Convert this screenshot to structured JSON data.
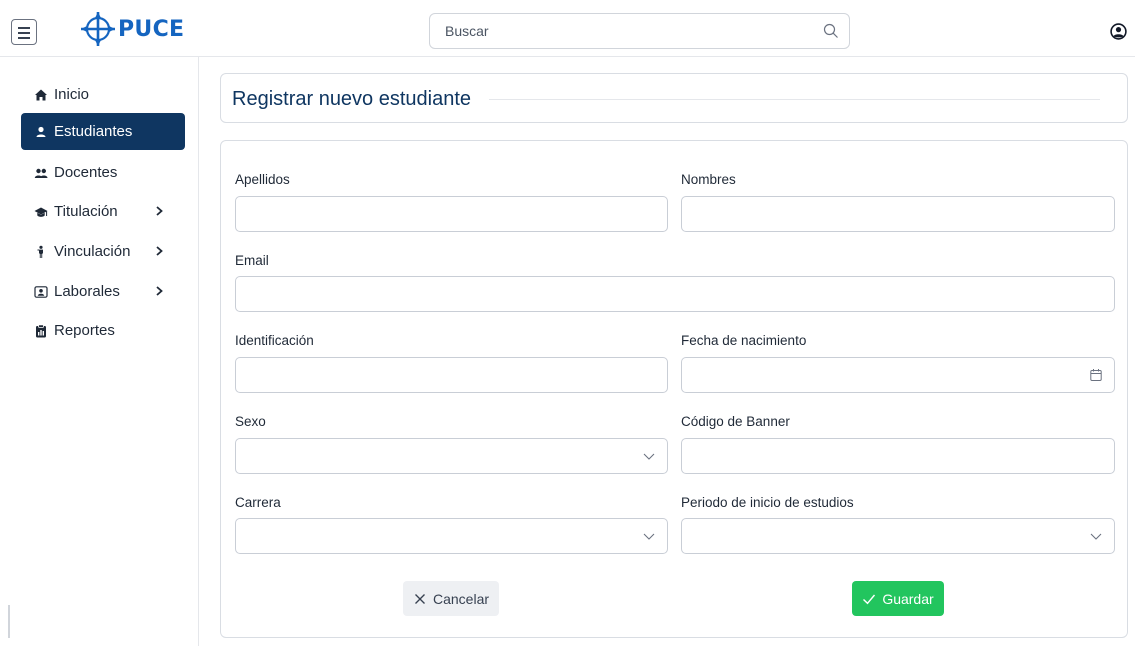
{
  "header": {
    "logo_text": "PUCE",
    "search_placeholder": "Buscar",
    "icons": {
      "menu": "hamburger-icon",
      "search": "search-icon",
      "user": "user-circle-icon",
      "logo": "compass-cross-logo"
    }
  },
  "sidebar": {
    "items": [
      {
        "label": "Inicio",
        "icon": "home-icon",
        "active": false,
        "expandable": false
      },
      {
        "label": "Estudiantes",
        "icon": "user-icon",
        "active": true,
        "expandable": false
      },
      {
        "label": "Docentes",
        "icon": "users-icon",
        "active": false,
        "expandable": false
      },
      {
        "label": "Titulación",
        "icon": "graduation-cap-icon",
        "active": false,
        "expandable": true
      },
      {
        "label": "Vinculación",
        "icon": "person-icon",
        "active": false,
        "expandable": true
      },
      {
        "label": "Laborales",
        "icon": "id-card-icon",
        "active": false,
        "expandable": true
      },
      {
        "label": "Reportes",
        "icon": "clipboard-icon",
        "active": false,
        "expandable": false
      }
    ]
  },
  "page": {
    "title": "Registrar nuevo estudiante"
  },
  "form": {
    "apellidos": {
      "label": "Apellidos",
      "value": ""
    },
    "nombres": {
      "label": "Nombres",
      "value": ""
    },
    "email": {
      "label": "Email",
      "value": ""
    },
    "identificacion": {
      "label": "Identificación",
      "value": ""
    },
    "fecha_nacimiento": {
      "label": "Fecha de nacimiento",
      "value": "",
      "icon": "calendar-icon"
    },
    "sexo": {
      "label": "Sexo",
      "value": "",
      "icon": "chevron-down-icon"
    },
    "codigo_banner": {
      "label": "Código de Banner",
      "value": ""
    },
    "carrera": {
      "label": "Carrera",
      "value": "",
      "icon": "chevron-down-icon"
    },
    "periodo_inicio": {
      "label": "Periodo de inicio de estudios",
      "value": "",
      "icon": "chevron-down-icon"
    },
    "cancel_label": "Cancelar",
    "save_label": "Guardar"
  },
  "colors": {
    "primary": "#0f3661",
    "brand_blue": "#1565c0",
    "success": "#22c55e",
    "border": "#d9dde3"
  }
}
